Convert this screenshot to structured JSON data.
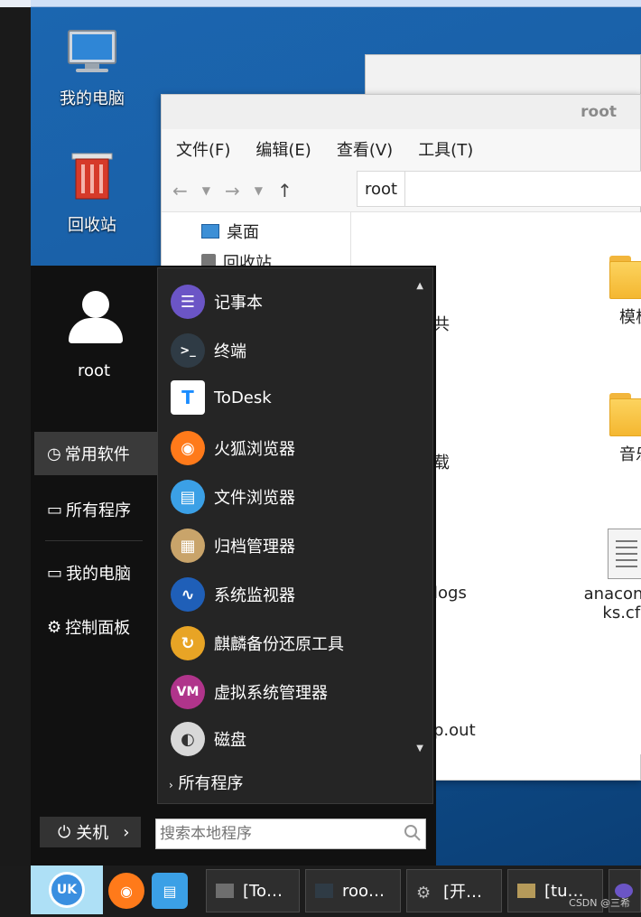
{
  "desktop": {
    "icons": [
      {
        "label": "我的电脑"
      },
      {
        "label": "回收站"
      }
    ]
  },
  "explorer": {
    "title": "root",
    "menus": [
      "文件(F)",
      "编辑(E)",
      "查看(V)",
      "工具(T)"
    ],
    "address": "root",
    "side_items": [
      "桌面",
      "回收站"
    ],
    "files": [
      "共",
      "模板",
      "载",
      "音乐",
      "logs",
      "anaconda-ks.cfg",
      "p.out"
    ]
  },
  "start_menu": {
    "user": "root",
    "nav": [
      "常用软件",
      "所有程序",
      "我的电脑",
      "控制面板"
    ],
    "apps": [
      "记事本",
      "终端",
      "ToDesk",
      "火狐浏览器",
      "文件浏览器",
      "归档管理器",
      "系统监视器",
      "麒麟备份还原工具",
      "虚拟系统管理器",
      "磁盘"
    ],
    "all_programs": "所有程序",
    "power_label": "关机",
    "search_placeholder": "搜索本地程序"
  },
  "taskbar": {
    "tasks": [
      "[To…",
      "roo…",
      "[开…",
      "[tu…"
    ],
    "watermark": "CSDN @三希"
  },
  "colors": {
    "desktop_blue": "#1a5fa6",
    "start_bg": "#111111",
    "applist_bg": "#252525",
    "taskbar_bg": "#1c1c1c"
  }
}
